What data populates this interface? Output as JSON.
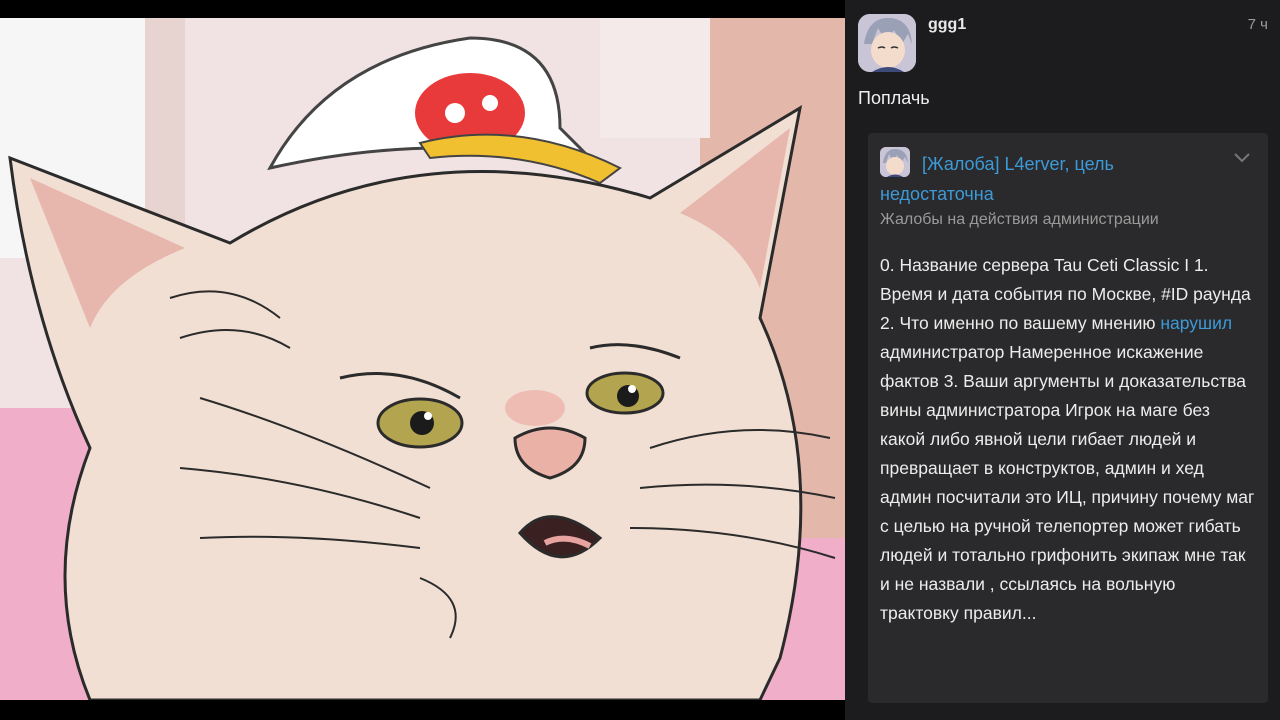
{
  "post": {
    "username": "ggg1",
    "time": "7 ч",
    "comment": "Поплачь"
  },
  "quote": {
    "title": "[Жалоба] L4erver, цель недостаточна",
    "category": "Жалобы на действия администрации",
    "body_before": "0. Название сервера Tau Ceti Classic I 1. Время и дата события по Москве, #ID раунда 2. Что именно по вашему мнению ",
    "body_link": "нарушил",
    "body_after": " администратор Намеренное искажение фактов 3. Ваши аргументы и доказательства вины администратора Игрок на маге без какой либо явной цели гибает людей и превращает в конструктов, админ и хед админ посчитали это ИЦ, причину почему маг с целью на ручной телепортер может гибать людей и тотально грифонить экипаж мне так и не назвали , ссылаясь на вольную трактовку правил..."
  },
  "colors": {
    "link": "#3d9ad8",
    "panel": "#1c1c1e",
    "card": "#2a2a2c"
  },
  "icons": {
    "avatar": "anime-avatar-icon",
    "collapse": "chevron-down-icon"
  }
}
